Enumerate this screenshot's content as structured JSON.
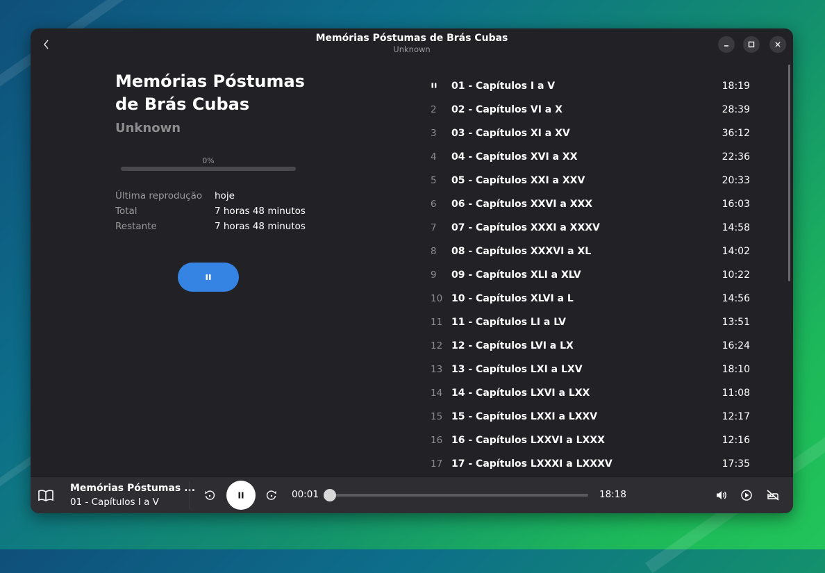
{
  "window": {
    "title": "Memórias Póstumas de Brás Cubas",
    "subtitle": "Unknown"
  },
  "book": {
    "title_line1": "Memórias Póstumas",
    "title_line2": "de Brás Cubas",
    "author": "Unknown",
    "progress_label": "0%",
    "progress_fraction": 0.0,
    "info": [
      {
        "key": "Última reprodução",
        "value": "hoje"
      },
      {
        "key": "Total",
        "value": "7 horas 48 minutos"
      },
      {
        "key": "Restante",
        "value": "7 horas 48 minutos"
      }
    ]
  },
  "tracks": [
    {
      "num": "",
      "name": "01 - Capítulos I a V",
      "duration": "18:19",
      "playing": true
    },
    {
      "num": "2",
      "name": "02 - Capítulos VI a X",
      "duration": "28:39"
    },
    {
      "num": "3",
      "name": "03 - Capítulos XI a XV",
      "duration": "36:12"
    },
    {
      "num": "4",
      "name": "04 - Capítulos XVI a XX",
      "duration": "22:36"
    },
    {
      "num": "5",
      "name": "05 - Capítulos XXI a XXV",
      "duration": "20:33"
    },
    {
      "num": "6",
      "name": "06 - Capítulos XXVI a XXX",
      "duration": "16:03"
    },
    {
      "num": "7",
      "name": "07 - Capítulos XXXI a XXXV",
      "duration": "14:58"
    },
    {
      "num": "8",
      "name": "08 - Capítulos XXXVI a XL",
      "duration": "14:02"
    },
    {
      "num": "9",
      "name": "09 - Capítulos XLI a XLV",
      "duration": "10:22"
    },
    {
      "num": "10",
      "name": "10 - Capítulos XLVI a L",
      "duration": "14:56"
    },
    {
      "num": "11",
      "name": "11 - Capítulos LI a LV",
      "duration": "13:51"
    },
    {
      "num": "12",
      "name": "12 - Capítulos LVI a LX",
      "duration": "16:24"
    },
    {
      "num": "13",
      "name": "13 - Capítulos LXI a LXV",
      "duration": "18:10"
    },
    {
      "num": "14",
      "name": "14 - Capítulos LXVI a LXX",
      "duration": "11:08"
    },
    {
      "num": "15",
      "name": "15 - Capítulos LXXI a LXXV",
      "duration": "12:17"
    },
    {
      "num": "16",
      "name": "16 - Capítulos LXXVI a LXXX",
      "duration": "12:16"
    },
    {
      "num": "17",
      "name": "17 - Capítulos LXXXI a LXXXV",
      "duration": "17:35"
    }
  ],
  "player": {
    "title": "Memórias Póstumas ...",
    "chapter": "01 - Capítulos I a V",
    "elapsed": "00:01",
    "total": "18:18",
    "seek_fraction": 0.0
  },
  "colors": {
    "accent": "#3584e4",
    "window_bg": "#222226",
    "player_bg": "#2e2e32"
  }
}
